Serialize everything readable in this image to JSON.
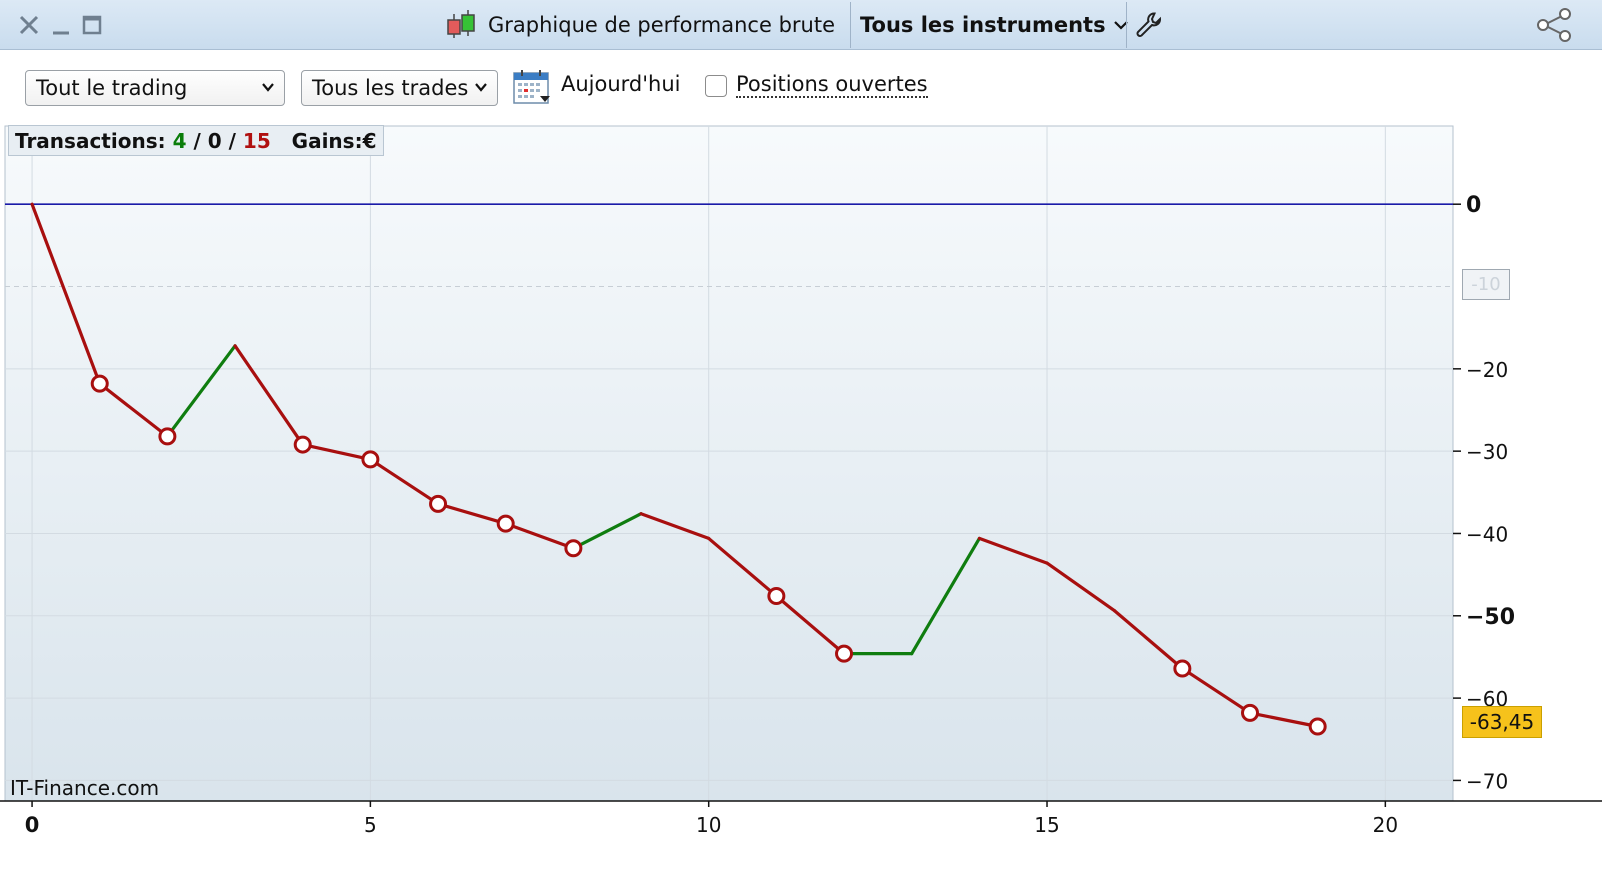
{
  "window": {
    "title": "Graphique de performance brute",
    "instrument_selector": "Tous les instruments"
  },
  "toolbar": {
    "trading_select": "Tout le trading",
    "trades_select": "Tous les trades",
    "date_label": "Aujourd'hui",
    "open_positions_label": "Positions ouvertes",
    "open_positions_checked": false
  },
  "stats": {
    "transactions_label": "Transactions:",
    "winners": "4",
    "neutral": "0",
    "losers": "15",
    "gains_label": "Gains:",
    "currency": "€",
    "sep1": "/",
    "sep2": "/"
  },
  "watermark": "IT-Finance.com",
  "last_value_label": "-63,45",
  "crosshair_label": "-10",
  "colors": {
    "loss": "#a80f0f",
    "gain": "#0f7d0f",
    "zero_line": "#1a1aa8",
    "last_badge": "#f6c21b"
  },
  "chart_data": {
    "type": "line",
    "title": "",
    "xlabel": "",
    "ylabel": "",
    "xlim": [
      -0.4,
      21
    ],
    "ylim": [
      -72.5,
      9.5
    ],
    "x_ticks": [
      0,
      5,
      10,
      15,
      20
    ],
    "y_ticks": [
      0,
      -20,
      -30,
      -40,
      -50,
      -60,
      -70
    ],
    "y_tick_labels": [
      "0",
      "−20",
      "−30",
      "−40",
      "−50",
      "−60",
      "−70"
    ],
    "x_tick_labels": [
      "0",
      "5",
      "10",
      "15",
      "20"
    ],
    "grid": true,
    "x": [
      0,
      1,
      2,
      3,
      4,
      5,
      6,
      7,
      8,
      9,
      10,
      11,
      12,
      13,
      14,
      15,
      16,
      17,
      18,
      19
    ],
    "y": [
      0,
      -21.8,
      -28.2,
      -17.2,
      -29.2,
      -31.0,
      -36.4,
      -38.8,
      -41.8,
      -37.6,
      -40.6,
      -47.6,
      -54.6,
      -54.6,
      -40.6,
      -43.6,
      -49.4,
      -56.4,
      -61.8,
      -63.45
    ],
    "segment_result": [
      "loss",
      "loss",
      "gain",
      "loss",
      "loss",
      "loss",
      "loss",
      "loss",
      "gain",
      "loss",
      "loss",
      "loss",
      "gain",
      "gain",
      "loss",
      "loss",
      "loss",
      "loss",
      "loss"
    ],
    "markers_at_x": [
      1,
      2,
      4,
      5,
      6,
      7,
      8,
      11,
      12,
      17,
      18,
      19
    ],
    "zero_line": 0,
    "crosshair_y": -10,
    "last_value": -63.45
  }
}
